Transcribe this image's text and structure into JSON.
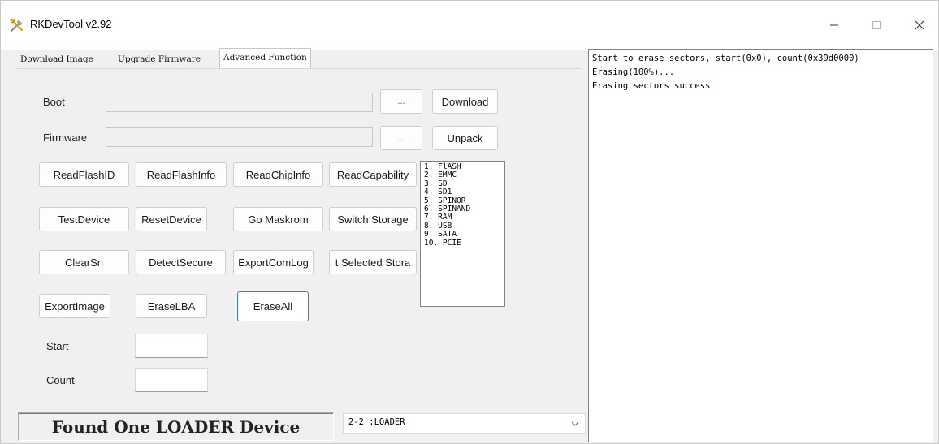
{
  "window": {
    "title": "RKDevTool v2.92"
  },
  "tabs": [
    {
      "label": "Download Image"
    },
    {
      "label": "Upgrade Firmware"
    },
    {
      "label": "Advanced Function"
    }
  ],
  "advanced": {
    "boot_label": "Boot",
    "boot_value": "",
    "boot_browse": "...",
    "boot_action": "Download",
    "firmware_label": "Firmware",
    "firmware_value": "",
    "firmware_browse": "...",
    "firmware_action": "Unpack",
    "buttons": [
      {
        "label": "ReadFlashID"
      },
      {
        "label": "ReadFlashInfo"
      },
      {
        "label": "ReadChipInfo"
      },
      {
        "label": "ReadCapability"
      },
      {
        "label": "TestDevice"
      },
      {
        "label": "ResetDevice"
      },
      {
        "label": "Go Maskrom"
      },
      {
        "label": "Switch Storage"
      },
      {
        "label": "ClearSn"
      },
      {
        "label": "DetectSecure"
      },
      {
        "label": "ExportComLog"
      },
      {
        "label": "t Selected Stora"
      },
      {
        "label": "ExportImage"
      },
      {
        "label": "EraseLBA"
      },
      {
        "label": "EraseAll"
      }
    ],
    "start_label": "Start",
    "start_value": "",
    "count_label": "Count",
    "count_value": "",
    "storage_options": [
      "1. FlASH",
      "2. EMMC",
      "3. SD",
      "4. SD1",
      "5. SPINOR",
      "6. SPINAND",
      "7. RAM",
      "8. USB",
      "9. SATA",
      "10. PCIE"
    ]
  },
  "status": {
    "text": "Found One LOADER Device"
  },
  "device_select": {
    "value": "2-2 :LOADER"
  },
  "log": {
    "lines": [
      "Start to erase sectors, start(0x0), count(0x39d0000)",
      "Erasing(100%)...",
      "Erasing sectors success"
    ]
  },
  "colors": {
    "focus_border": "#3a7bd5",
    "window_bg": "#f0f0f0"
  }
}
